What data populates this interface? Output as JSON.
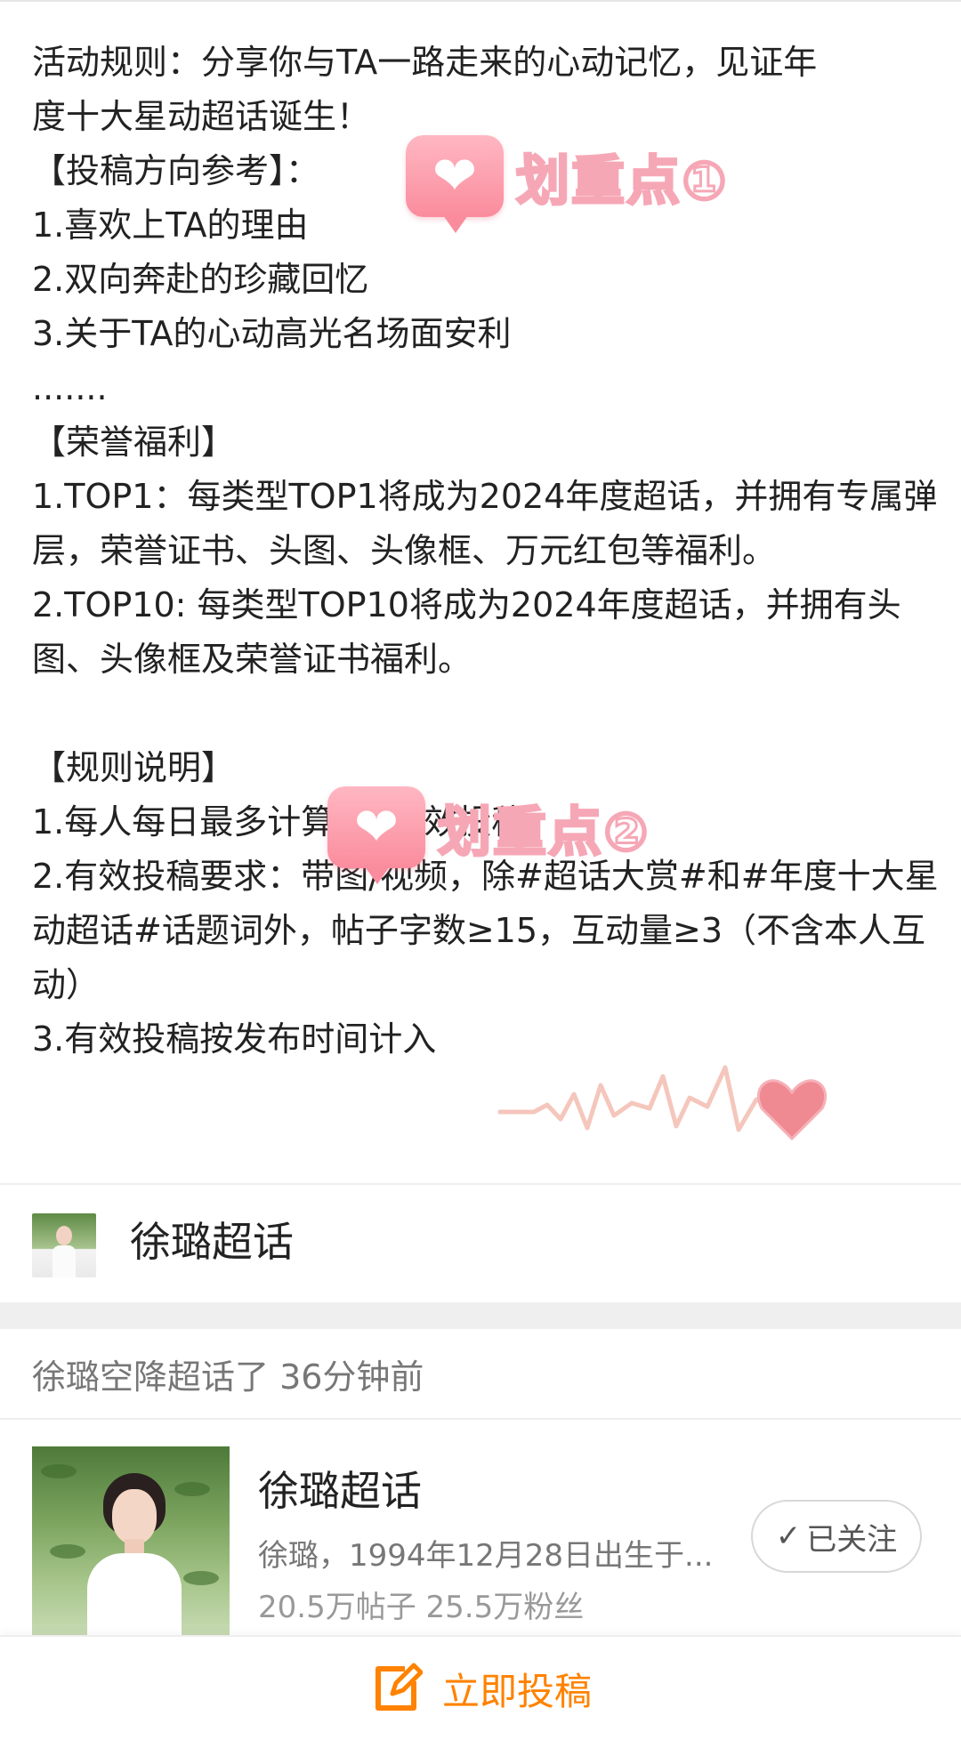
{
  "rules_lines": [
    "活动规则：分享你与TA一路走来的心动记忆，见证年",
    "度十大星动超话诞生！",
    "【投稿方向参考】：",
    "1.喜欢上TA的理由",
    "2.双向奔赴的珍藏回忆",
    "3.关于TA的心动高光名场面安利",
    ".......",
    "【荣誉福利】",
    "1.TOP1：每类型TOP1将成为2024年度超话，并拥有专属弹层，荣誉证书、头图、头像框、万元红包等福利。",
    "2.TOP10: 每类型TOP10将成为2024年度超话，并拥有头图、头像框及荣誉证书福利。",
    "【规则说明】",
    "1.每人每日最多计算3次有效投稿",
    "2.有效投稿要求：带图/视频，除#超话大赏#和#年度十大星动超话#话题词外，帖子字数≥15，互动量≥3（不含本人互动）",
    "3.有效投稿按发布时间计入"
  ],
  "stickers": {
    "one": "划重点①",
    "two": "划重点②"
  },
  "topic": {
    "name": "徐璐超话"
  },
  "activity_text": "徐璐空降超话了 36分钟前",
  "card": {
    "name": "徐璐超话",
    "desc": "徐璐，1994年12月28日出生于...",
    "stats": "20.5万帖子  25.5万粉丝",
    "follow_label": "已关注"
  },
  "bottom": {
    "post_label": "立即投稿"
  },
  "colors": {
    "accent": "#ff8200",
    "sticker_pink": "#fa8c9d"
  },
  "icons": [
    "heart-icon",
    "check-icon",
    "edit-icon"
  ]
}
